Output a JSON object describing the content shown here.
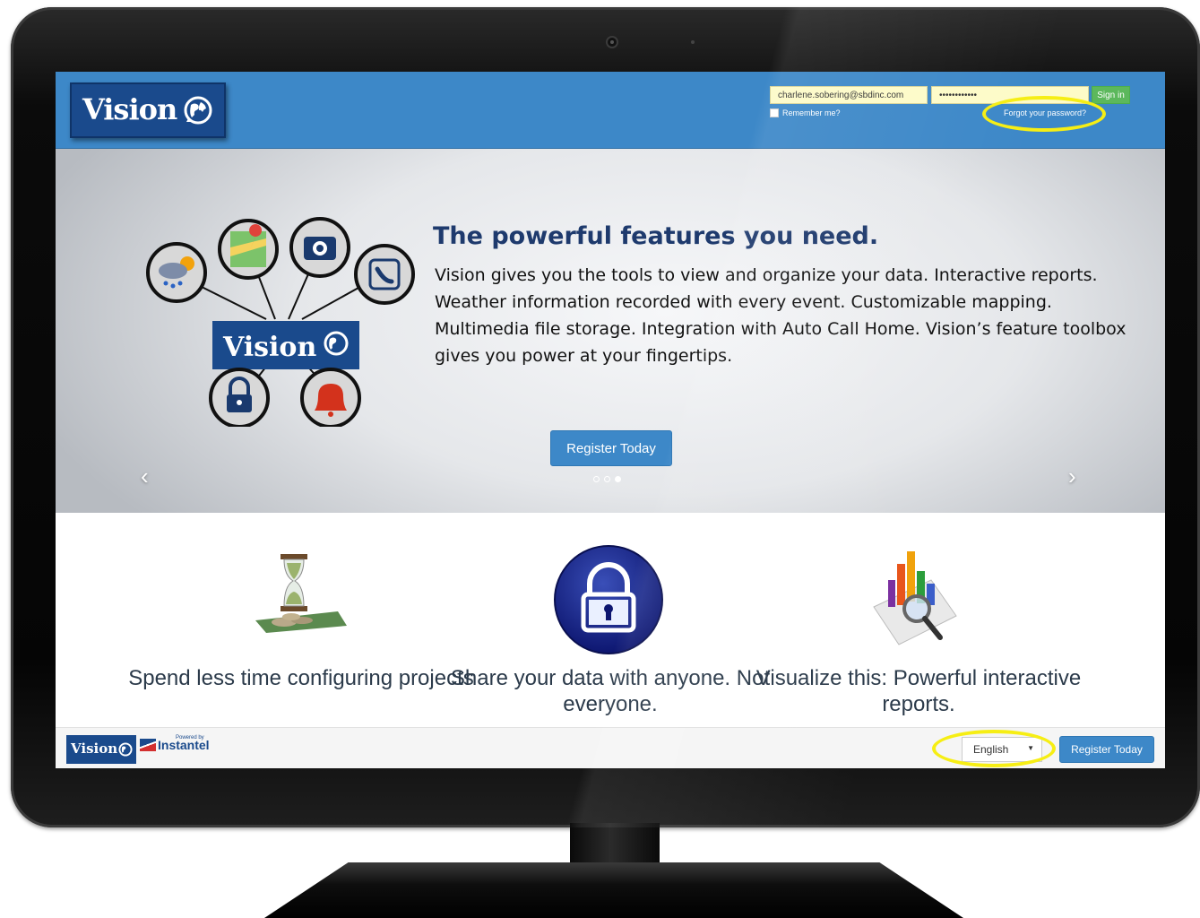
{
  "header": {
    "logo_text": "Vision",
    "email_value": "charlene.sobering@sbdinc.com",
    "password_value": "••••••••••••",
    "signin_label": "Sign in",
    "remember_label": "Remember me?",
    "forgot_label": "Forgot your password?"
  },
  "hero": {
    "diagram_logo_text": "Vision",
    "title": "The powerful features you need.",
    "body": "Vision gives you the tools to view and organize your data.  Interactive reports.  Weather information recorded with every event.  Customizable mapping.  Multimedia file storage.  Integration with Auto Call Home.  Vision’s feature toolbox gives you power at your fingertips.",
    "register_label": "Register Today",
    "arrow_left": "‹",
    "arrow_right": "›",
    "active_slide": 3,
    "slide_count": 3
  },
  "features": [
    {
      "title": "Spend less time configuring projects",
      "icon": "hourglass-coins-icon"
    },
    {
      "title": "Share your data with anyone. Not everyone.",
      "icon": "padlock-icon"
    },
    {
      "title": "Visualize this: Powerful interactive reports.",
      "icon": "chart-magnifier-icon"
    }
  ],
  "footer": {
    "logo_text": "Vision",
    "powered_by": "Powered by",
    "instantel_text": "Instantel",
    "language_value": "English",
    "register_label": "Register Today"
  },
  "colors": {
    "header_blue": "#3d88c8",
    "logo_navy": "#1a4a8c",
    "signin_green": "#5cb85c",
    "input_yellow": "#fdfbc8",
    "highlight_yellow": "#f6ee14",
    "title_navy": "#1e3a6d"
  }
}
